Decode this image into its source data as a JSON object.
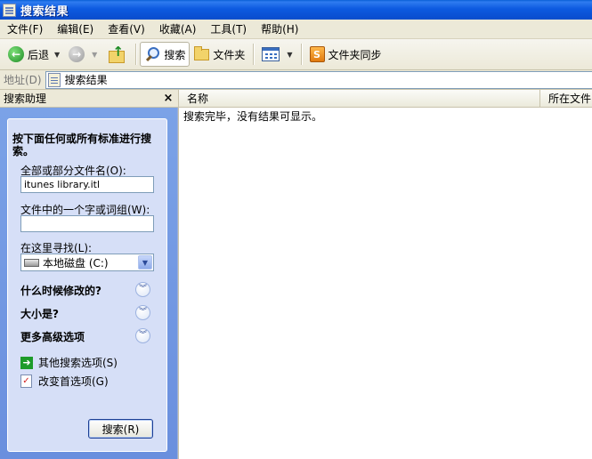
{
  "window": {
    "title": "搜索结果"
  },
  "menu": [
    "文件(F)",
    "编辑(E)",
    "查看(V)",
    "收藏(A)",
    "工具(T)",
    "帮助(H)"
  ],
  "toolbar": {
    "back_label": "后退",
    "search_label": "搜索",
    "folders_label": "文件夹",
    "sync_label": "文件夹同步"
  },
  "address": {
    "label": "地址(D)",
    "value": "搜索结果"
  },
  "assistant": {
    "title": "搜索助理",
    "close_glyph": "×",
    "heading": "按下面任何或所有标准进行搜索。",
    "filename_label": "全部或部分文件名(O):",
    "filename_value": "itunes library.itl",
    "word_label": "文件中的一个字或词组(W):",
    "word_value": "",
    "lookin_label": "在这里寻找(L):",
    "lookin_value": "本地磁盘 (C:)",
    "sections": [
      "什么时候修改的?",
      "大小是?",
      "更多高级选项"
    ],
    "links": [
      "其他搜索选项(S)",
      "改变首选项(G)"
    ],
    "search_button": "搜索(R)"
  },
  "results": {
    "columns": [
      "名称",
      "所在文件"
    ],
    "empty_message": "搜索完毕，没有结果可显示。"
  }
}
